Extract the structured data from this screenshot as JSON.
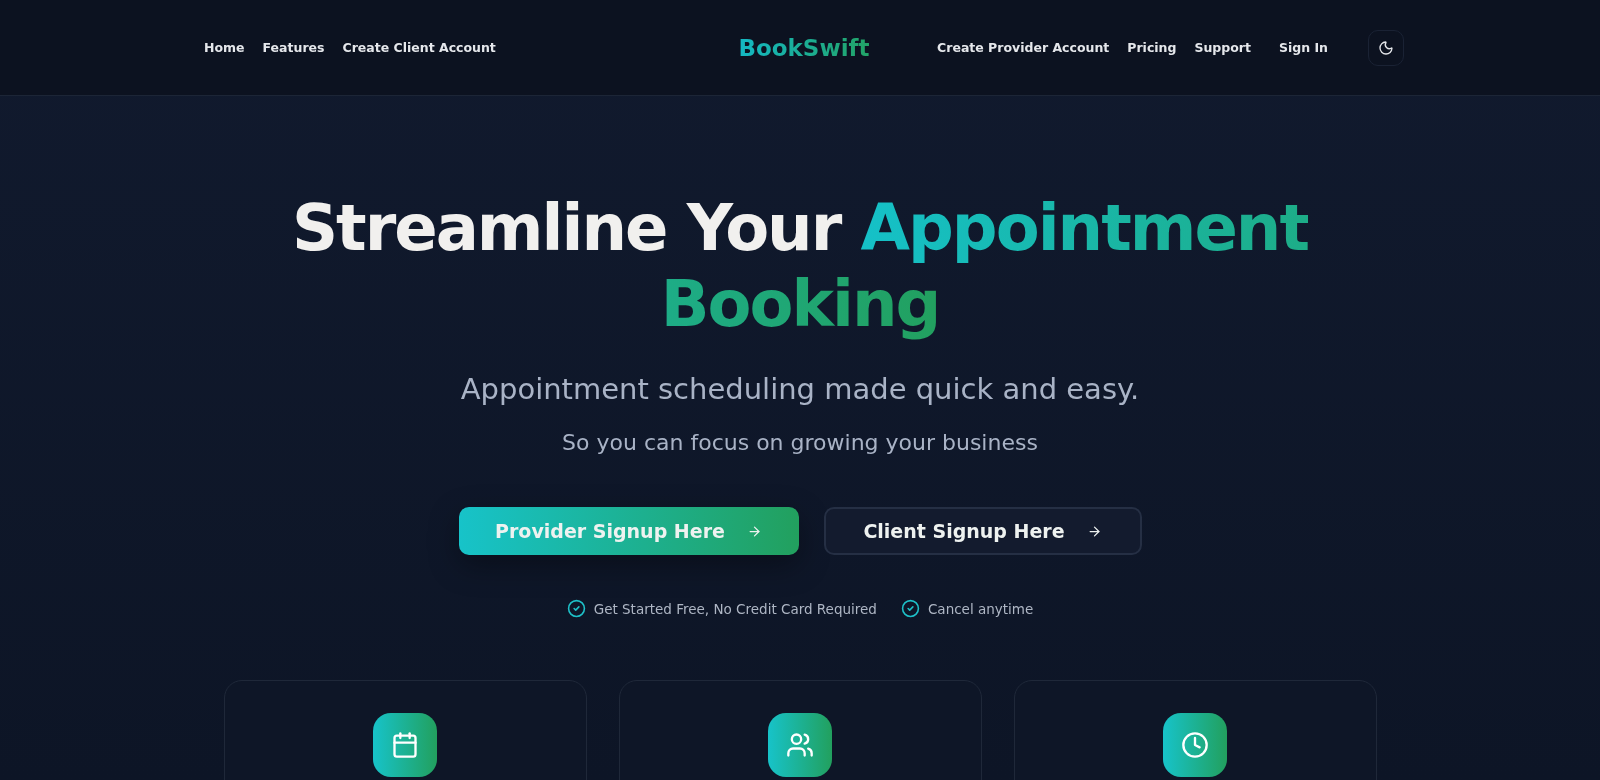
{
  "nav": {
    "left_links": [
      "Home",
      "Features",
      "Create Client Account"
    ],
    "brand": "BookSwift",
    "right_links": [
      "Create Provider Account",
      "Pricing",
      "Support"
    ],
    "sign_in": "Sign In"
  },
  "hero": {
    "title": [
      {
        "text": "Streamline Your ",
        "kind": "plain"
      },
      {
        "text": "Appointment Booking",
        "kind": "accent"
      }
    ],
    "subtitle": "Appointment scheduling made quick and easy.",
    "tagline": "So you can focus on growing your business",
    "buttons": [
      {
        "label": "Provider Signup Here",
        "kind": "primary"
      },
      {
        "label": "Client Signup Here",
        "kind": "secondary"
      }
    ],
    "perks": [
      "Get Started Free, No Credit Card Required",
      "Cancel anytime"
    ]
  },
  "cards": [
    {
      "kind": "calendar"
    },
    {
      "kind": "users"
    },
    {
      "kind": "clock"
    }
  ]
}
